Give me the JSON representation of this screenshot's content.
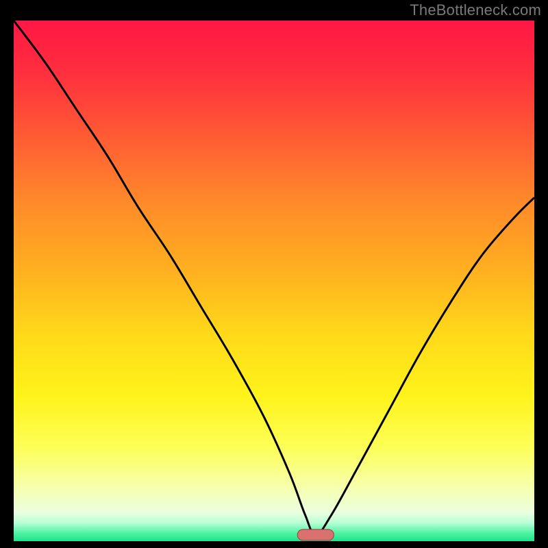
{
  "header": {
    "watermark": "TheBottleneck.com"
  },
  "colors": {
    "page_bg": "#000000",
    "curve": "#000000",
    "marker_fill": "#d8716f",
    "marker_stroke": "#9a3f3d",
    "gradient_stops": [
      {
        "offset": 0.0,
        "color": "#ff1744"
      },
      {
        "offset": 0.1,
        "color": "#ff2f3f"
      },
      {
        "offset": 0.22,
        "color": "#ff5a34"
      },
      {
        "offset": 0.35,
        "color": "#ff8a2a"
      },
      {
        "offset": 0.48,
        "color": "#ffb020"
      },
      {
        "offset": 0.6,
        "color": "#ffd81a"
      },
      {
        "offset": 0.72,
        "color": "#fff31a"
      },
      {
        "offset": 0.82,
        "color": "#fdff57"
      },
      {
        "offset": 0.9,
        "color": "#f6ffb0"
      },
      {
        "offset": 0.945,
        "color": "#eaffe0"
      },
      {
        "offset": 0.965,
        "color": "#b6ffd4"
      },
      {
        "offset": 0.985,
        "color": "#4cf3a2"
      },
      {
        "offset": 1.0,
        "color": "#1de38a"
      }
    ]
  },
  "chart_data": {
    "type": "line",
    "title": "",
    "xlabel": "",
    "ylabel": "",
    "xlim": [
      0,
      100
    ],
    "ylim": [
      0,
      100
    ],
    "grid": false,
    "legend": false,
    "optimum_x": 58,
    "marker": {
      "x_center": 58,
      "y": 1.2,
      "width": 7,
      "height": 2
    },
    "series": [
      {
        "name": "bottleneck-curve",
        "x": [
          0,
          6,
          12,
          18,
          24,
          30,
          36,
          42,
          48,
          53,
          56,
          58,
          61,
          66,
          72,
          78,
          84,
          90,
          96,
          100
        ],
        "y": [
          100,
          92,
          83,
          74,
          64,
          55,
          45,
          35,
          24,
          13,
          5,
          1.2,
          5,
          14,
          25,
          36,
          46,
          55,
          62,
          66
        ]
      }
    ]
  }
}
